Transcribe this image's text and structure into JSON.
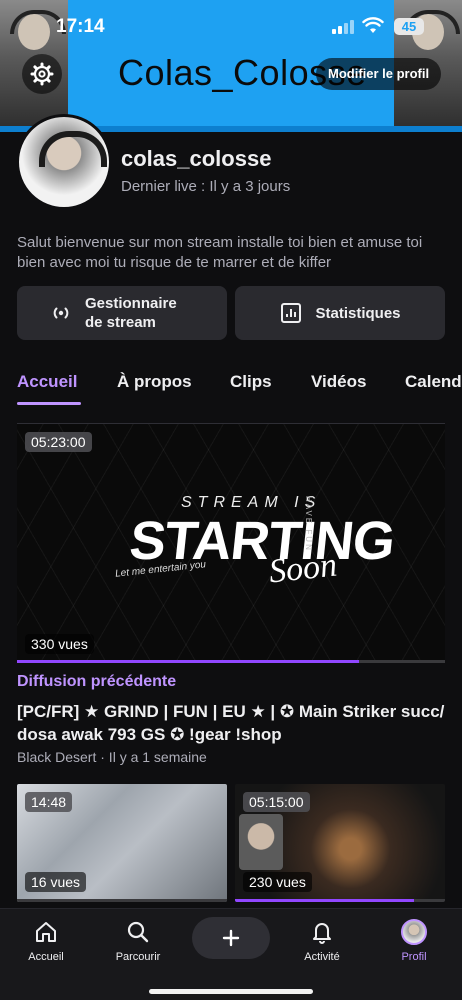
{
  "status_bar": {
    "time": "17:14",
    "battery": "45"
  },
  "banner": {
    "title": "Colas_Colosse"
  },
  "header": {
    "edit_profile_label": "Modifier le profil"
  },
  "profile": {
    "username": "colas_colosse",
    "last_live": "Dernier live : Il y a 3 jours",
    "bio": "Salut bienvenue sur mon stream installe toi bien et amuse toi bien avec moi tu risque de te marrer et de kiffer"
  },
  "actions": {
    "stream_manager_label": "Gestionnaire de stream",
    "stats_label": "Statistiques"
  },
  "tabs": [
    {
      "label": "Accueil",
      "active": true
    },
    {
      "label": "À propos",
      "active": false
    },
    {
      "label": "Clips",
      "active": false
    },
    {
      "label": "Vidéos",
      "active": false
    },
    {
      "label": "Calend",
      "active": false
    }
  ],
  "featured": {
    "duration": "05:23:00",
    "views": "330 vues",
    "progress": 0.8,
    "thumbnail": {
      "line1": "STREAM IS",
      "line2": "STARTING",
      "line3": "Soon",
      "tagline": "Let me entertain you",
      "side": "HAVE FUN"
    },
    "category_label": "Diffusion précédente",
    "title": "[PC/FR] ★ GRIND | FUN | EU ★ | ✪ Main Striker succ/ dosa awak 793 GS ✪ !gear !shop",
    "subtitle": "Black Desert · Il y a 1 semaine"
  },
  "videos": [
    {
      "duration": "14:48",
      "views": "16 vues",
      "progress": 0.0
    },
    {
      "duration": "05:15:00",
      "views": "230 vues",
      "progress": 0.85
    }
  ],
  "bottom_nav": {
    "home": "Accueil",
    "browse": "Parcourir",
    "activity": "Activité",
    "profile": "Profil"
  },
  "colors": {
    "accent": "#bf94ff",
    "brand": "#9147ff",
    "banner": "#1ea1f2"
  }
}
